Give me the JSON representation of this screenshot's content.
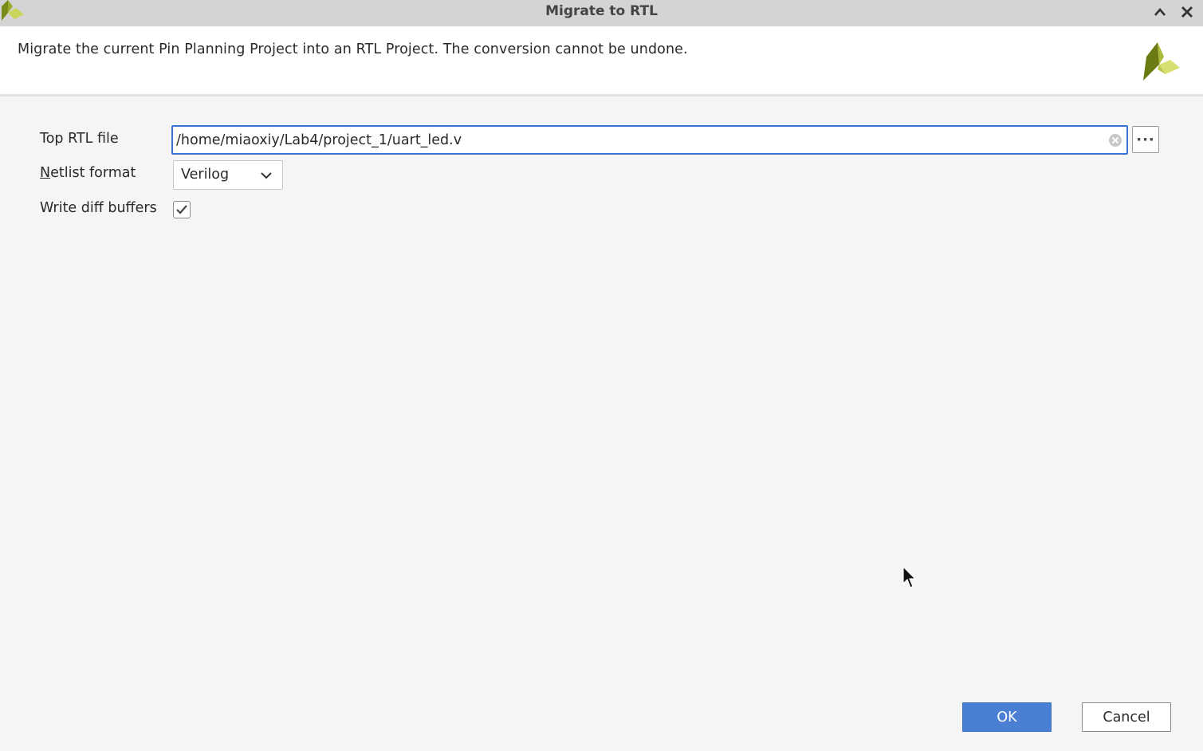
{
  "window": {
    "title": "Migrate to RTL",
    "collapse_icon": "chevron-up-icon",
    "close_icon": "close-icon"
  },
  "banner": {
    "description": "Migrate the current Pin Planning Project into an RTL Project. The conversion cannot be undone.",
    "logo": "vivado-logo"
  },
  "form": {
    "top_rtl_file": {
      "label": "Top RTL file",
      "value": "/home/miaoxiy/Lab4/project_1/uart_led.v",
      "browse_label": "···"
    },
    "netlist_format": {
      "label": "Netlist format",
      "mnemonic": "N",
      "label_rest": "etlist format",
      "selected": "Verilog"
    },
    "write_diff_buffers": {
      "label": "Write diff buffers",
      "checked": true
    }
  },
  "buttons": {
    "ok": "OK",
    "cancel": "Cancel"
  },
  "colors": {
    "accent": "#4a7fd4",
    "focus_border": "#3a73d6",
    "titlebar": "#d4d4d4"
  }
}
